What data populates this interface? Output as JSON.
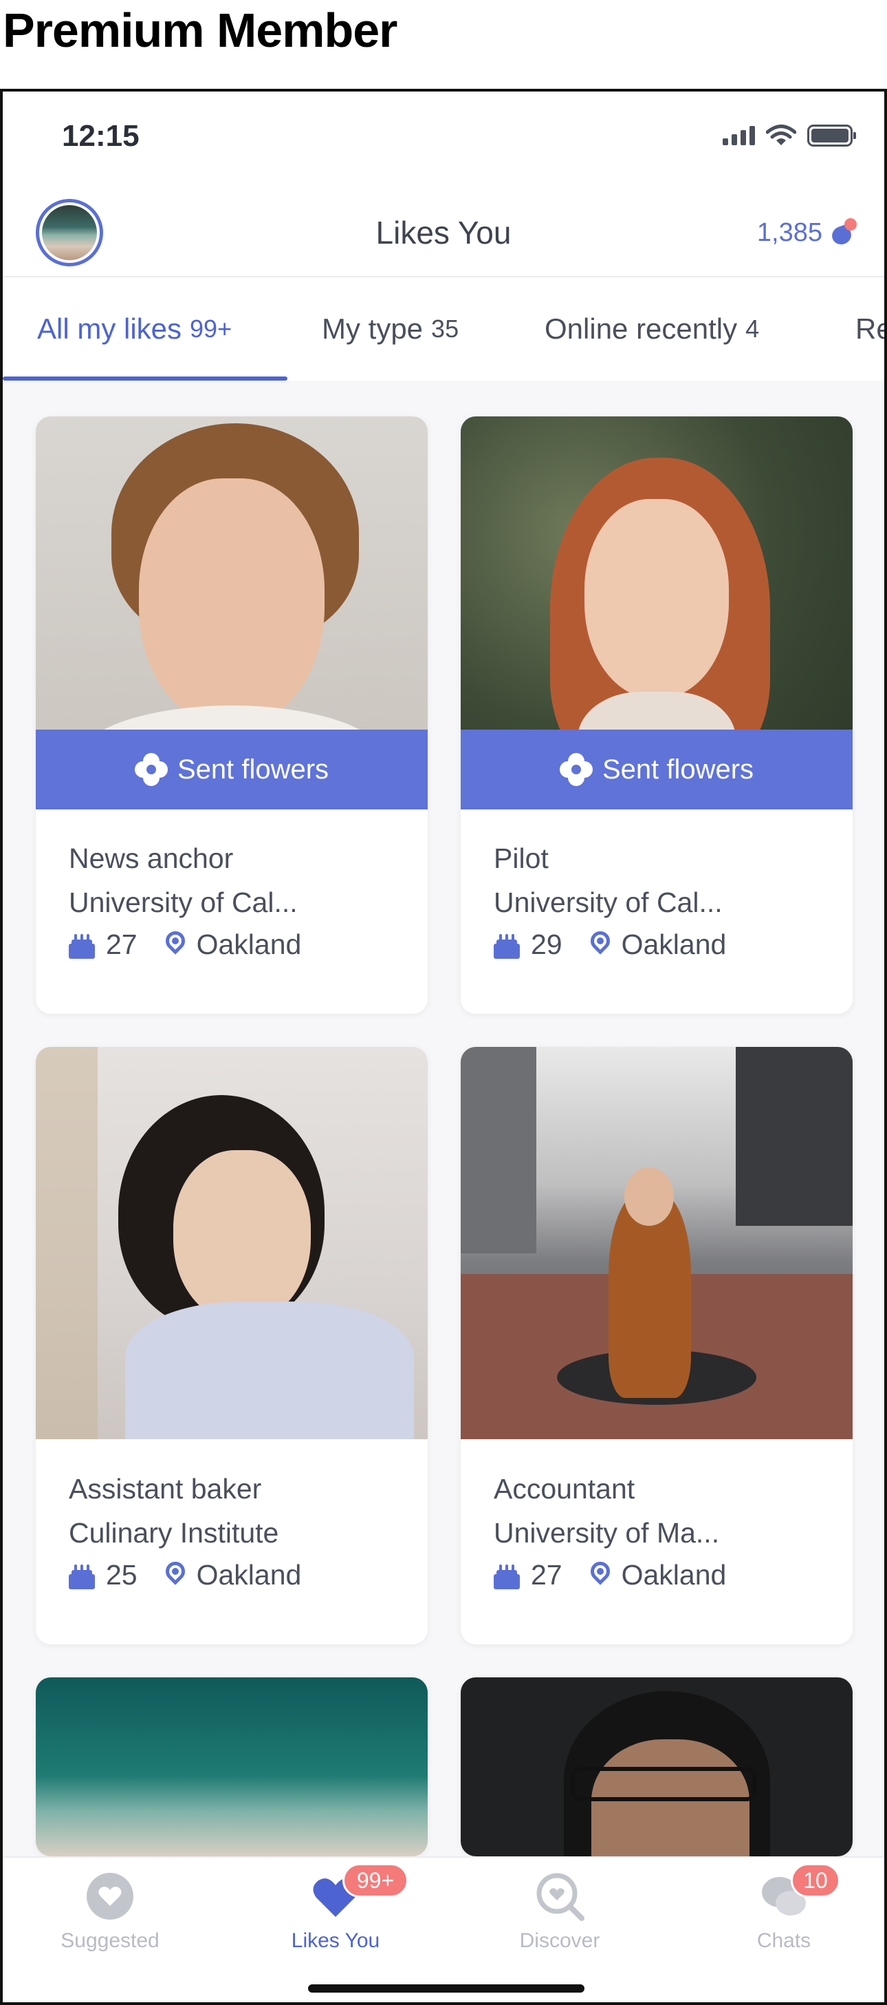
{
  "page_heading": "Premium Member",
  "status_bar": {
    "time": "12:15"
  },
  "header": {
    "title": "Likes You",
    "credits": "1,385"
  },
  "tabs": [
    {
      "label": "All my likes",
      "count": "99+"
    },
    {
      "label": "My type",
      "count": "35"
    },
    {
      "label": "Online recently",
      "count": "4"
    },
    {
      "label": "Re",
      "count": ""
    }
  ],
  "cards": [
    {
      "sent_label": "Sent flowers",
      "line1": "News anchor",
      "line2": "University of Cal...",
      "age": "27",
      "location": "Oakland"
    },
    {
      "sent_label": "Sent flowers",
      "line1": "Pilot",
      "line2": "University of Cal...",
      "age": "29",
      "location": "Oakland"
    },
    {
      "sent_label": "",
      "line1": "Assistant baker",
      "line2": "Culinary Institute",
      "age": "25",
      "location": "Oakland"
    },
    {
      "sent_label": "",
      "line1": "Accountant",
      "line2": "University of Ma...",
      "age": "27",
      "location": "Oakland"
    }
  ],
  "nav": [
    {
      "label": "Suggested",
      "badge": ""
    },
    {
      "label": "Likes You",
      "badge": "99+"
    },
    {
      "label": "Discover",
      "badge": ""
    },
    {
      "label": "Chats",
      "badge": "10"
    }
  ],
  "colors": {
    "accent": "#4d63d2",
    "badge": "#f57a7a",
    "sent_bar": "#5f73d8"
  }
}
